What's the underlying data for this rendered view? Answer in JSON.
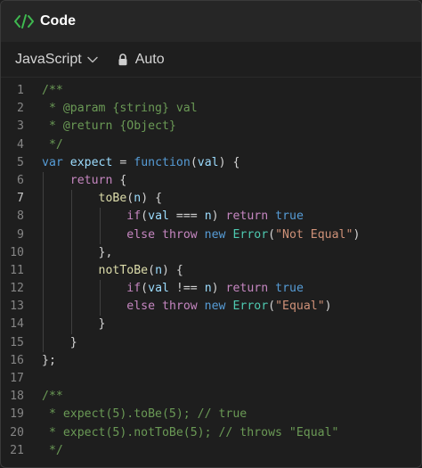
{
  "header": {
    "title": "Code",
    "icon": "code-brackets-icon"
  },
  "toolbar": {
    "language": "JavaScript",
    "mode": "Auto"
  },
  "colors": {
    "accent": "#3fb950",
    "comment": "#6a9955",
    "keyword": "#569cd6",
    "variable": "#9cdcfe",
    "function": "#dcdcaa",
    "string": "#ce9178",
    "type": "#4ec9b0"
  },
  "code": {
    "line_numbers": [
      "1",
      "2",
      "3",
      "4",
      "5",
      "6",
      "7",
      "8",
      "9",
      "10",
      "11",
      "12",
      "13",
      "14",
      "15",
      "16",
      "17",
      "18",
      "19",
      "20",
      "21"
    ],
    "lines": [
      "/**",
      " * @param {string} val",
      " * @return {Object}",
      " */",
      "var expect = function(val) {",
      "    return {",
      "        toBe(n) {",
      "            if(val === n) return true",
      "            else throw new Error(\"Not Equal\")",
      "        },",
      "        notToBe(n) {",
      "            if(val !== n) return true",
      "            else throw new Error(\"Equal\")",
      "        }",
      "    }",
      "};",
      "",
      "/**",
      " * expect(5).toBe(5); // true",
      " * expect(5).notToBe(5); // throws \"Equal\"",
      " */"
    ]
  }
}
